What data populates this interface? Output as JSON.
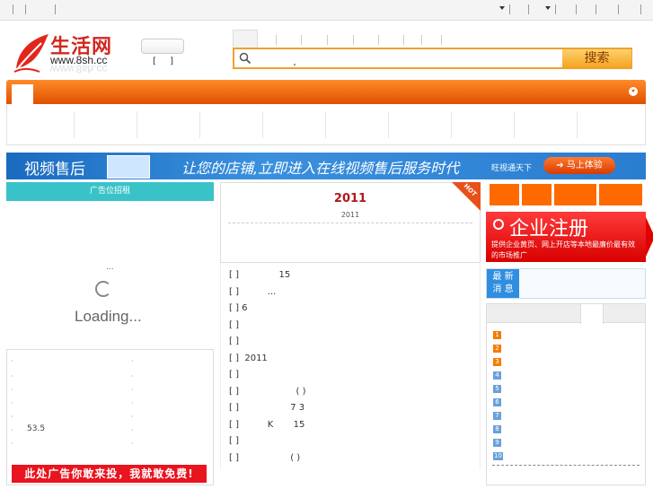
{
  "header": {
    "logo_cn": "生活网",
    "logo_url": "www.8sh.cc",
    "city_switch": "[ ]"
  },
  "search": {
    "button_label": "搜索",
    "icon": "search-icon"
  },
  "banner": {
    "text1": "视频售后",
    "text2": "让您的店铺,立即进入在线视频售后服务时代",
    "text3": "旺视通天下",
    "button": "马上体验"
  },
  "left": {
    "ad_head": "广告位招租",
    "loading_dots": "...",
    "loading_text": "Loading...",
    "price": "53.5",
    "red_ad": "此处广告你敢来投，我就敢免费!"
  },
  "middle": {
    "title": "2011",
    "subtitle": "2011",
    "hot": "HOT",
    "rows": [
      "[ ]              15",
      "[ ]          ...",
      "[ ] 6",
      "[ ]",
      "[ ]",
      "[ ]  2011",
      "[ ]",
      "[ ]                    ( )",
      "[ ]                  7 3",
      "[ ]          K       15",
      "[ ]",
      "[ ]                  ( )"
    ]
  },
  "right": {
    "register_title": "企业注册",
    "register_desc": "提供企业黄页、网上开店等本地最廉价最有效的市场推广",
    "news_label_1": "最 新",
    "news_label_2": "消 息",
    "rank_numbers": [
      "1",
      "2",
      "3",
      "4",
      "5",
      "6",
      "7",
      "8",
      "9",
      "10"
    ]
  },
  "colors": {
    "accent_orange": "#e05000",
    "brand_red": "#d2281f",
    "teal": "#39c3c8",
    "banner_blue": "#2a7dd0"
  }
}
